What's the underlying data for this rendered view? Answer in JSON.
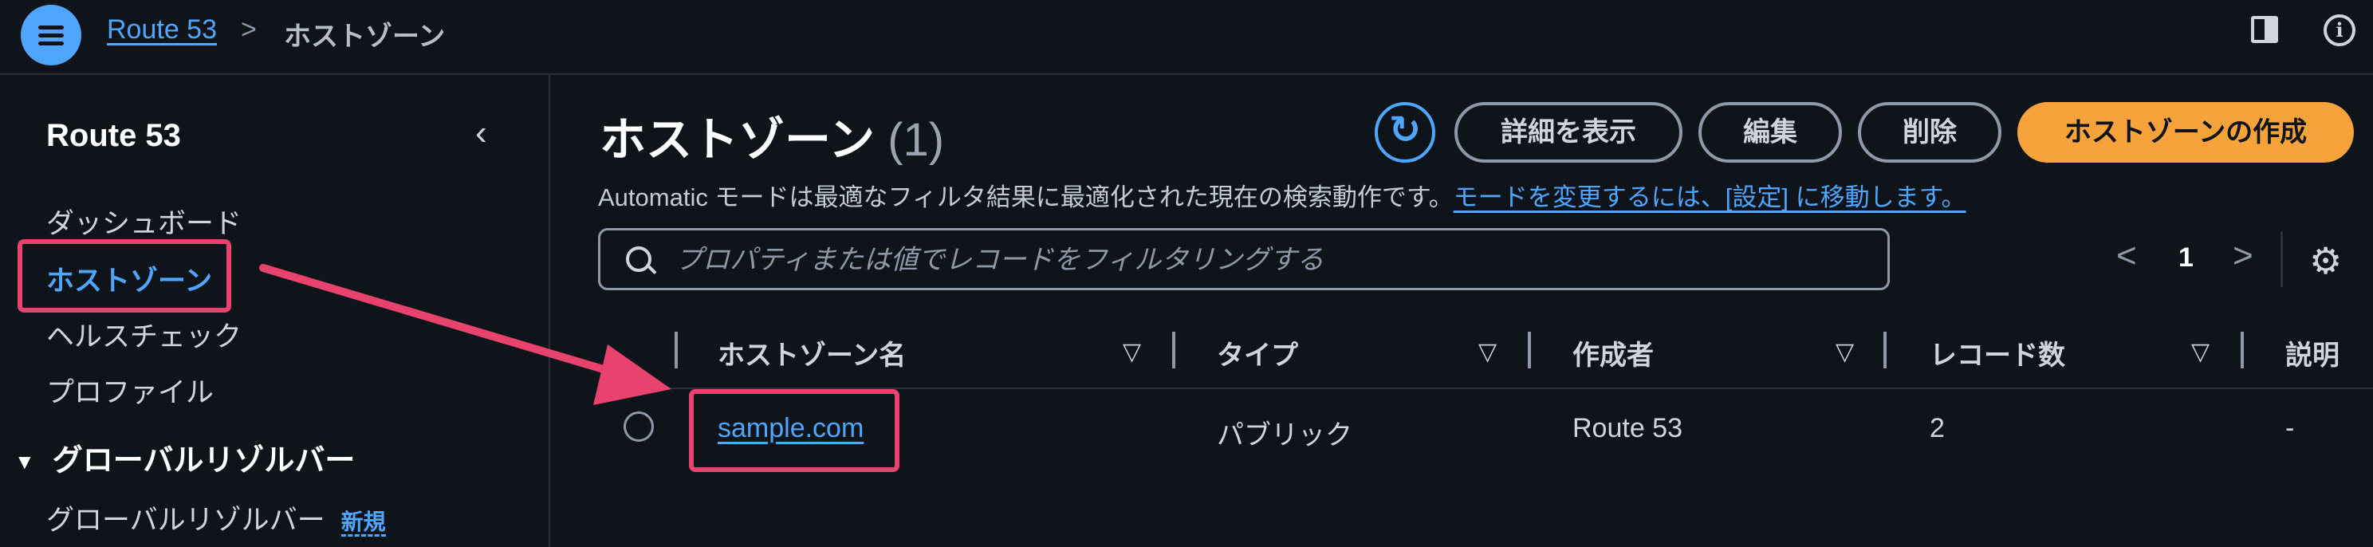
{
  "topbar": {
    "breadcrumb_service": "Route 53",
    "breadcrumb_separator": ">",
    "breadcrumb_current": "ホストゾーン"
  },
  "sidebar": {
    "title": "Route 53",
    "collapse_icon": "chevron-left-icon",
    "items": [
      {
        "label": "ダッシュボード",
        "active": false
      },
      {
        "label": "ホストゾーン",
        "active": true
      },
      {
        "label": "ヘルスチェック",
        "active": false
      },
      {
        "label": "プロファイル",
        "active": false
      }
    ],
    "section": {
      "label": "グローバルリゾルバー",
      "items": [
        {
          "label": "グローバルリゾルバー",
          "badge": "新規"
        }
      ]
    }
  },
  "main": {
    "title": "ホストゾーン",
    "count": "(1)",
    "buttons": {
      "details": "詳細を表示",
      "edit": "編集",
      "delete": "削除",
      "create": "ホストゾーンの作成"
    },
    "info_text": "Automatic モードは最適なフィルタ結果に最適化された現在の検索動作です。",
    "info_link": "モードを変更するには、[設定] に移動します。",
    "search": {
      "placeholder": "プロパティまたは値でレコードをフィルタリングする",
      "value": ""
    },
    "pagination": {
      "prev": "<",
      "page": "1",
      "next": ">"
    },
    "table": {
      "columns": [
        "ホストゾーン名",
        "タイプ",
        "作成者",
        "レコード数",
        "説明"
      ],
      "rows": [
        {
          "name": "sample.com",
          "type": "パブリック",
          "created_by": "Route 53",
          "record_count": "2",
          "description": "-"
        }
      ]
    }
  },
  "colors": {
    "background": "#0f141a",
    "accent_blue": "#4ea6ff",
    "primary_orange": "#f6a33b",
    "annotation_pink": "#e8436f"
  }
}
